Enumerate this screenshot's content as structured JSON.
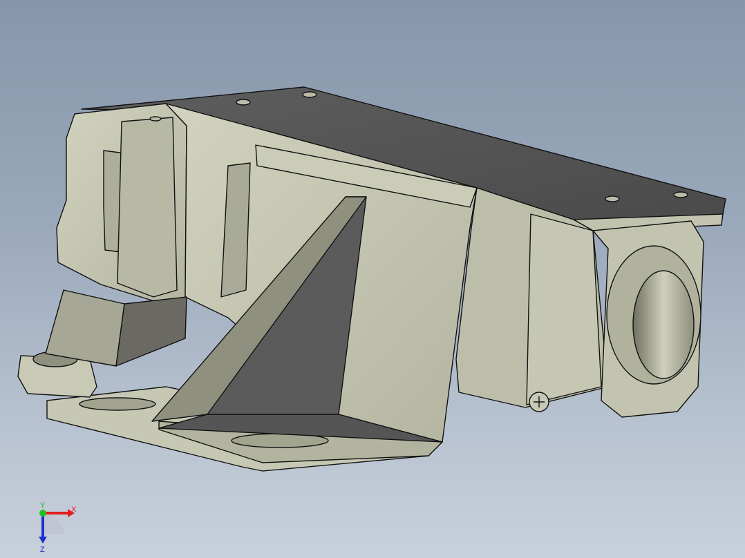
{
  "viewport": {
    "background_top": "#8796aa",
    "background_bottom": "#c8d0db"
  },
  "model": {
    "face_light": "#c0c1ad",
    "face_mid": "#a9aa97",
    "face_dark": "#5a5a5a",
    "face_darker": "#4a4a4a",
    "edge_color": "#000000"
  },
  "triad": {
    "x_label": "X",
    "y_label": "Y",
    "z_label": "Z",
    "x_color": "#e02020",
    "y_color": "#20c020",
    "z_color": "#2030d0"
  }
}
